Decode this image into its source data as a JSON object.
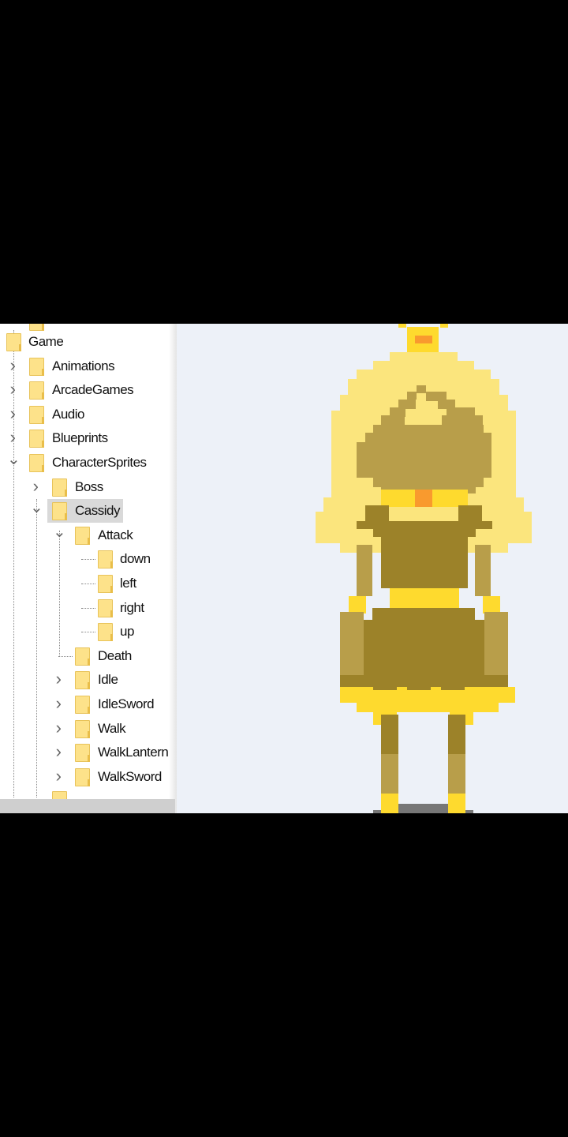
{
  "tree": {
    "items": [
      {
        "label": "Game",
        "level": 0,
        "chevron": "none"
      },
      {
        "label": "Animations",
        "level": 1,
        "chevron": "right"
      },
      {
        "label": "ArcadeGames",
        "level": 1,
        "chevron": "right"
      },
      {
        "label": "Audio",
        "level": 1,
        "chevron": "right"
      },
      {
        "label": "Blueprints",
        "level": 1,
        "chevron": "right"
      },
      {
        "label": "CharacterSprites",
        "level": 1,
        "chevron": "down"
      },
      {
        "label": "Boss",
        "level": 2,
        "chevron": "right"
      },
      {
        "label": "Cassidy",
        "level": 2,
        "chevron": "down",
        "selected": true
      },
      {
        "label": "Attack",
        "level": 3,
        "chevron": "down"
      },
      {
        "label": "down",
        "level": 4,
        "chevron": "none"
      },
      {
        "label": "left",
        "level": 4,
        "chevron": "none"
      },
      {
        "label": "right",
        "level": 4,
        "chevron": "none"
      },
      {
        "label": "up",
        "level": 4,
        "chevron": "none"
      },
      {
        "label": "Death",
        "level": 3,
        "chevron": "none"
      },
      {
        "label": "Idle",
        "level": 3,
        "chevron": "right"
      },
      {
        "label": "IdleSword",
        "level": 3,
        "chevron": "right"
      },
      {
        "label": "Walk",
        "level": 3,
        "chevron": "right"
      },
      {
        "label": "WalkLantern",
        "level": 3,
        "chevron": "right"
      },
      {
        "label": "WalkSword",
        "level": 3,
        "chevron": "right"
      }
    ]
  },
  "preview": {
    "colors": {
      "background": "#edf1f8",
      "hair": "#fbe57d",
      "skin_shadow": "#b89e4a",
      "dress": "#9c8229",
      "gold": "#feda2e",
      "gem": "#f99a2e",
      "base": "#777777"
    }
  }
}
